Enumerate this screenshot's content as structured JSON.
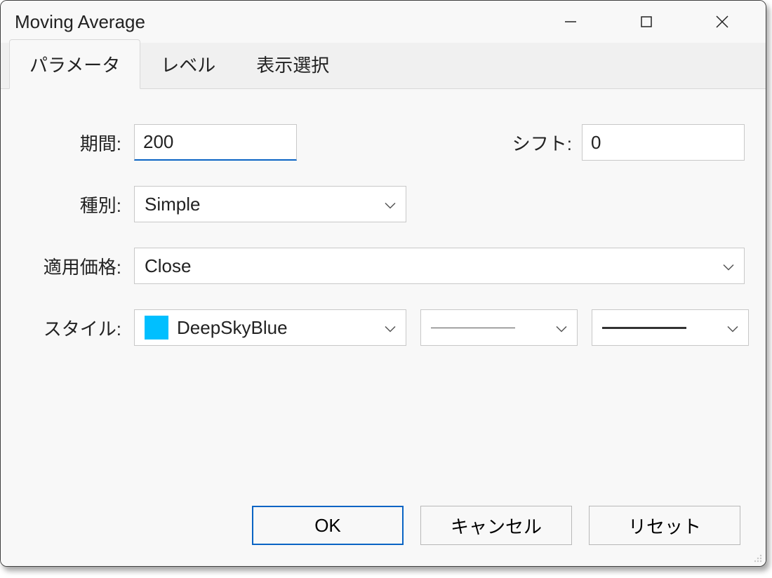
{
  "window": {
    "title": "Moving Average"
  },
  "tabs": [
    {
      "label": "パラメータ",
      "active": true
    },
    {
      "label": "レベル",
      "active": false
    },
    {
      "label": "表示選択",
      "active": false
    }
  ],
  "form": {
    "period_label": "期間:",
    "period_value": "200",
    "shift_label": "シフト:",
    "shift_value": "0",
    "method_label": "種別:",
    "method_value": "Simple",
    "apply_label": "適用価格:",
    "apply_value": "Close",
    "style_label": "スタイル:",
    "color_name": "DeepSkyBlue",
    "color_hex": "#00bfff",
    "line_style": "solid-thin",
    "line_width": "solid-thick"
  },
  "buttons": {
    "ok": "OK",
    "cancel": "キャンセル",
    "reset": "リセット"
  }
}
